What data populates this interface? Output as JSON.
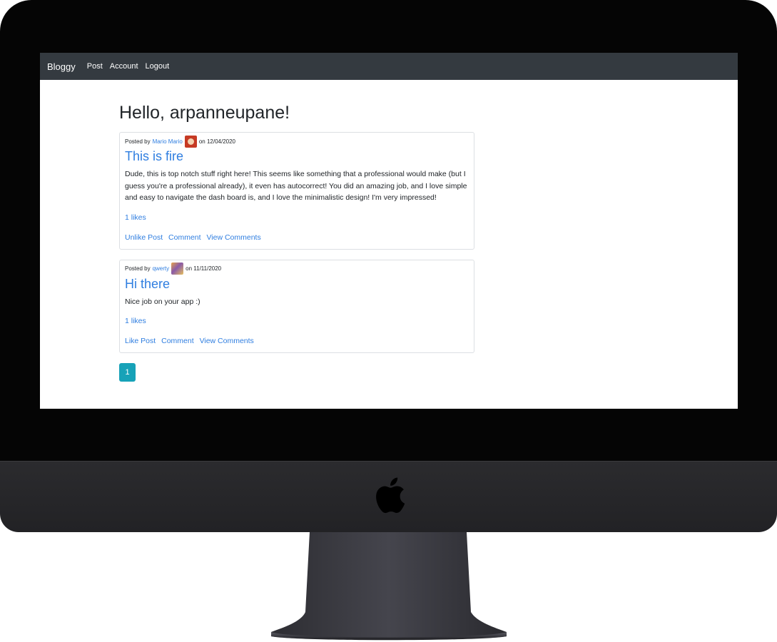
{
  "navbar": {
    "brand": "Bloggy",
    "links": [
      "Post",
      "Account",
      "Logout"
    ]
  },
  "greeting": "Hello, arpanneupane!",
  "posts": [
    {
      "posted_by_label": "Posted by",
      "author": "Mario Mario",
      "on_label": "on",
      "date": "12/04/2020",
      "avatar_icon": "mario-avatar",
      "title": "This is fire",
      "body": "Dude, this is top notch stuff right here! This seems like something that a professional would make (but I guess you're a professional already), it even has autocorrect! You did an amazing job, and I love simple and easy to navigate the dash board is, and I love the minimalistic design! I'm very impressed!",
      "likes": "1 likes",
      "like_action": "Unlike Post",
      "comment_action": "Comment",
      "view_comments_action": "View Comments"
    },
    {
      "posted_by_label": "Posted by",
      "author": "qwerty",
      "on_label": "on",
      "date": "11/11/2020",
      "avatar_icon": "qwerty-avatar",
      "title": "Hi there",
      "body": "Nice job on your app :)",
      "likes": "1 likes",
      "like_action": "Like Post",
      "comment_action": "Comment",
      "view_comments_action": "View Comments"
    }
  ],
  "pagination": {
    "current_page": "1"
  },
  "colors": {
    "navbar_bg": "#343a40",
    "link": "#2f7ee0",
    "page_button": "#17a2b8"
  }
}
